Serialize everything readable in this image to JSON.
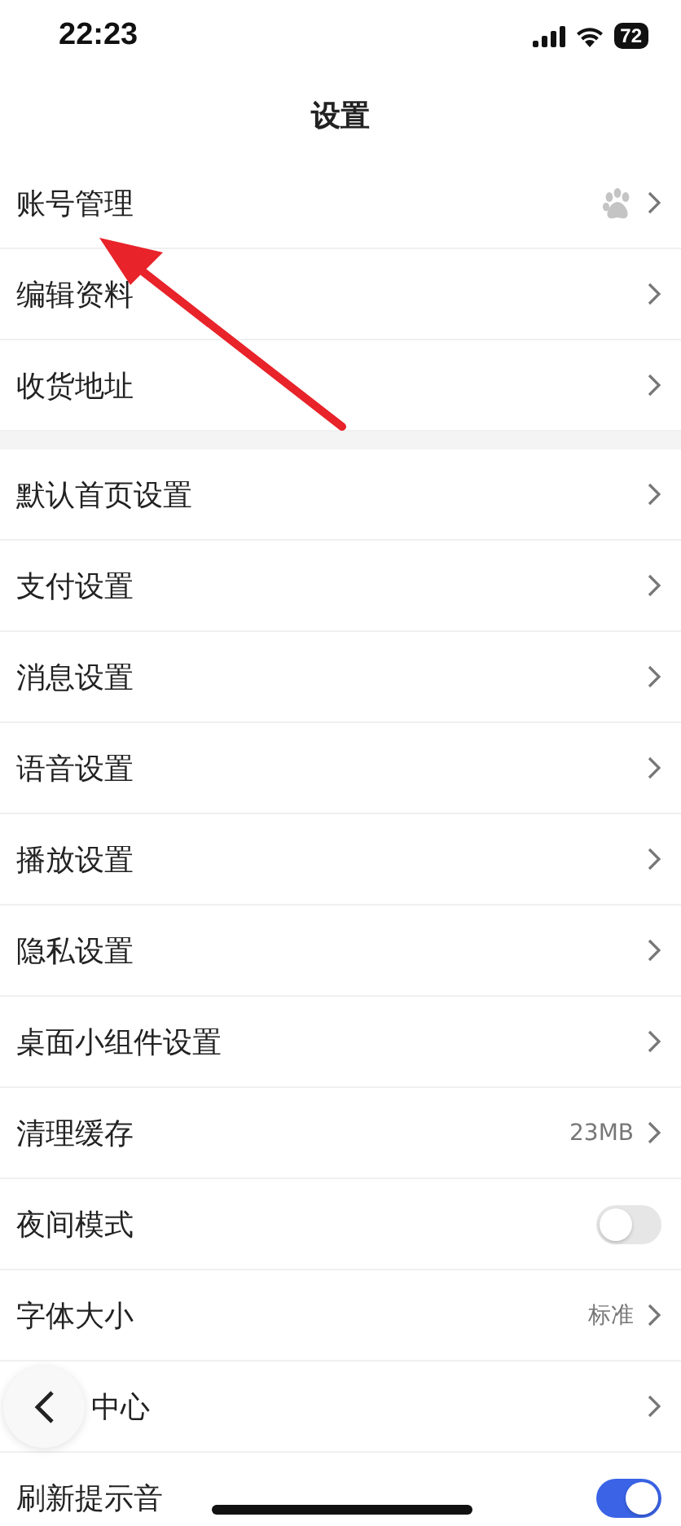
{
  "status_bar": {
    "time": "22:23",
    "battery": "72"
  },
  "title": "设置",
  "sections": [
    {
      "rows": [
        {
          "label": "账号管理",
          "kind": "account"
        },
        {
          "label": "编辑资料",
          "kind": "link"
        },
        {
          "label": "收货地址",
          "kind": "link"
        }
      ]
    },
    {
      "rows": [
        {
          "label": "默认首页设置",
          "kind": "link"
        },
        {
          "label": "支付设置",
          "kind": "link"
        },
        {
          "label": "消息设置",
          "kind": "link"
        },
        {
          "label": "语音设置",
          "kind": "link"
        },
        {
          "label": "播放设置",
          "kind": "link"
        },
        {
          "label": "隐私设置",
          "kind": "link"
        },
        {
          "label": "桌面小组件设置",
          "kind": "link"
        },
        {
          "label": "清理缓存",
          "kind": "link",
          "value": "23MB"
        },
        {
          "label": "夜间模式",
          "kind": "toggle",
          "on": false
        },
        {
          "label": "字体大小",
          "kind": "link",
          "value": "标准"
        },
        {
          "label": "中心",
          "kind": "link"
        },
        {
          "label": "刷新提示音",
          "kind": "toggle",
          "on": true
        }
      ]
    }
  ]
}
